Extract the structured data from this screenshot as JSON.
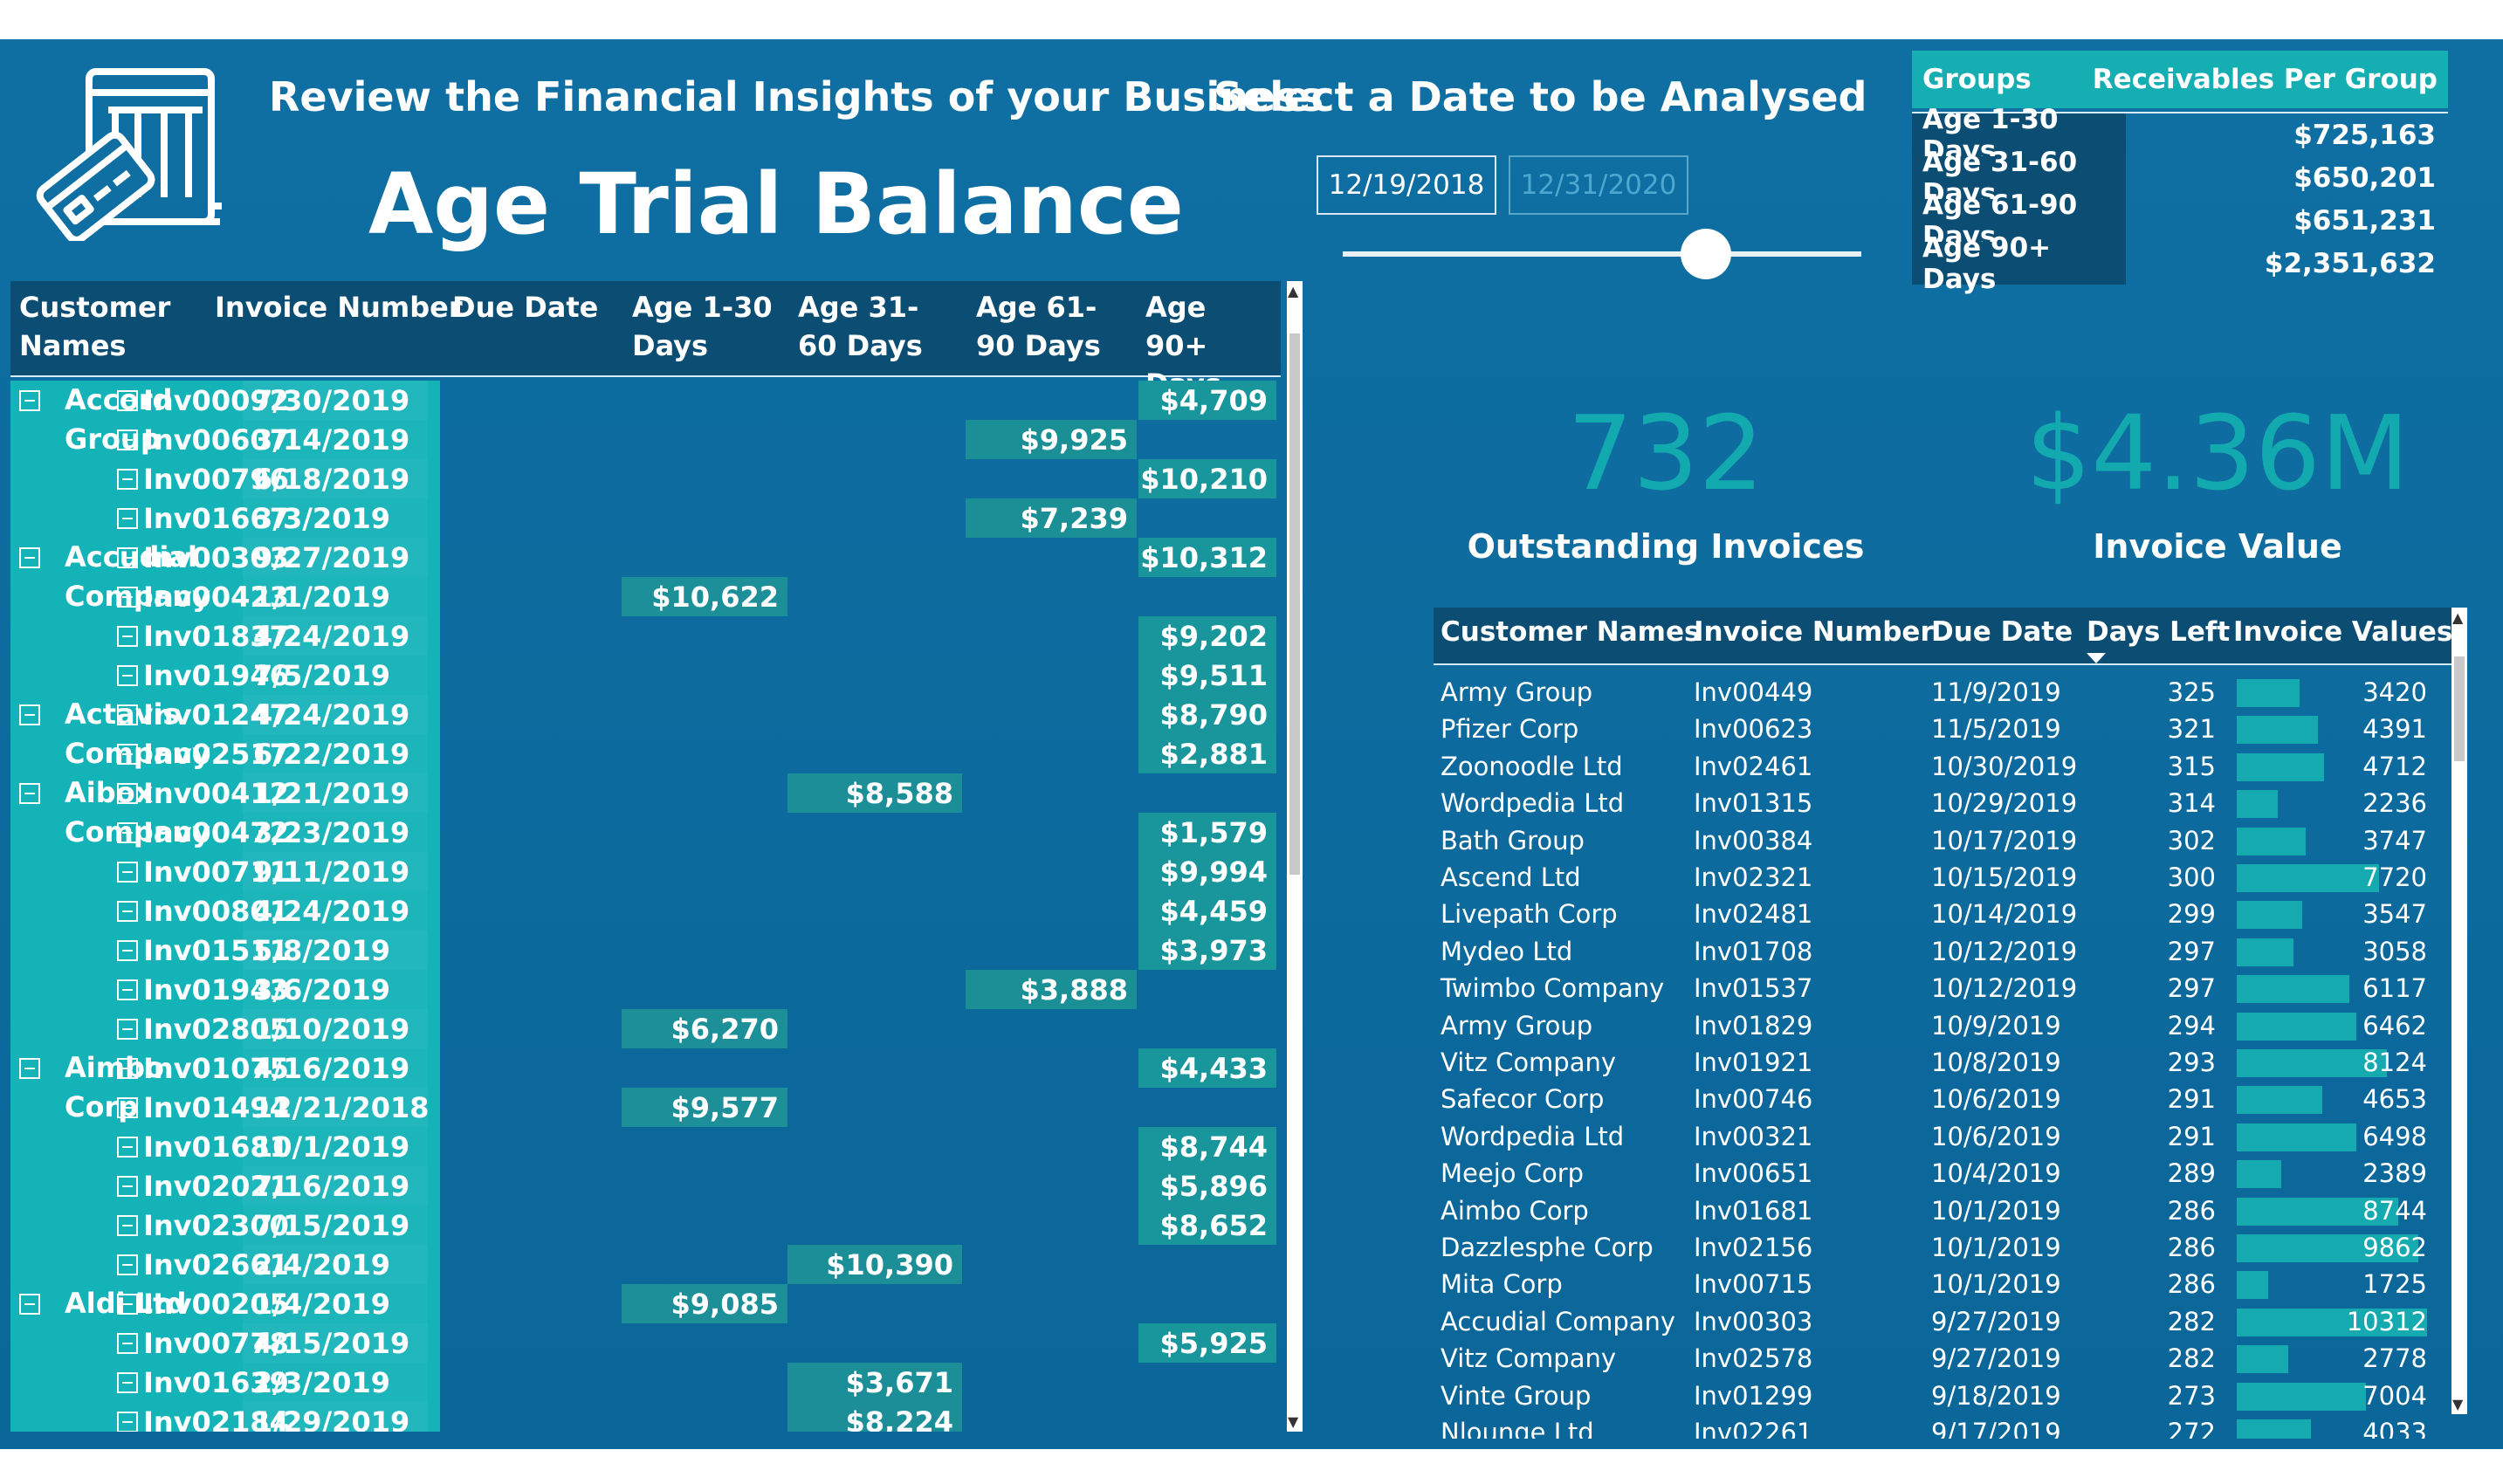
{
  "header": {
    "headline": "Review the Financial Insights of your Business",
    "select_date_label": "Select a Date to be Analysed",
    "page_title": "Age Trial Balance"
  },
  "date_filter": {
    "start": "12/19/2018",
    "end": "12/31/2020",
    "slider_position": 0.7
  },
  "groups_table": {
    "headers": [
      "Groups",
      "Receivables Per Group"
    ],
    "rows": [
      {
        "group": "Age 1-30 Days",
        "value": "$725,163"
      },
      {
        "group": "Age 31-60 Days",
        "value": "$650,201"
      },
      {
        "group": "Age 61-90 Days",
        "value": "$651,231"
      },
      {
        "group": "Age 90+ Days",
        "value": "$2,351,632"
      }
    ]
  },
  "kpis": {
    "outstanding_invoices": {
      "value": "732",
      "label": "Outstanding Invoices"
    },
    "invoice_value": {
      "value": "$4.36M",
      "label": "Invoice Value"
    }
  },
  "matrix": {
    "headers": {
      "customer": "Customer Names",
      "invoice": "Invoice Number",
      "due": "Due Date",
      "age1": "Age 1-30 Days",
      "age2": "Age 31-60 Days",
      "age3": "Age 61-90 Days",
      "age4": "Age 90+ Days"
    },
    "customers": [
      {
        "name": "Accord Group",
        "start": 0
      },
      {
        "name": "Accudial Company",
        "start": 4
      },
      {
        "name": "Actavis Company",
        "start": 8
      },
      {
        "name": "Aibox Company",
        "start": 10
      },
      {
        "name": "Aimbo Corp",
        "start": 17
      },
      {
        "name": "Aldi Ltd",
        "start": 23
      }
    ],
    "rows": [
      {
        "invoice": "Inv00092",
        "due": "7/30/2019",
        "age": 4,
        "value": "$4,709"
      },
      {
        "invoice": "Inv00607",
        "due": "3/14/2019",
        "age": 3,
        "value": "$9,925"
      },
      {
        "invoice": "Inv00796",
        "due": "6/18/2019",
        "age": 4,
        "value": "$10,210"
      },
      {
        "invoice": "Inv01667",
        "due": "3/3/2019",
        "age": 3,
        "value": "$7,239"
      },
      {
        "invoice": "Inv00303",
        "due": "9/27/2019",
        "age": 4,
        "value": "$10,312"
      },
      {
        "invoice": "Inv00423",
        "due": "1/1/2019",
        "age": 1,
        "value": "$10,622"
      },
      {
        "invoice": "Inv01837",
        "due": "4/24/2019",
        "age": 4,
        "value": "$9,202"
      },
      {
        "invoice": "Inv01946",
        "due": "7/5/2019",
        "age": 4,
        "value": "$9,511"
      },
      {
        "invoice": "Inv01247",
        "due": "4/24/2019",
        "age": 4,
        "value": "$8,790"
      },
      {
        "invoice": "Inv02517",
        "due": "6/22/2019",
        "age": 4,
        "value": "$2,881"
      },
      {
        "invoice": "Inv00412",
        "due": "1/21/2019",
        "age": 2,
        "value": "$8,588"
      },
      {
        "invoice": "Inv00472",
        "due": "3/23/2019",
        "age": 4,
        "value": "$1,579"
      },
      {
        "invoice": "Inv00711",
        "due": "9/11/2019",
        "age": 4,
        "value": "$9,994"
      },
      {
        "invoice": "Inv00801",
        "due": "4/24/2019",
        "age": 4,
        "value": "$4,459"
      },
      {
        "invoice": "Inv01511",
        "due": "5/8/2019",
        "age": 4,
        "value": "$3,973"
      },
      {
        "invoice": "Inv01943",
        "due": "3/6/2019",
        "age": 3,
        "value": "$3,888"
      },
      {
        "invoice": "Inv02805",
        "due": "1/10/2019",
        "age": 1,
        "value": "$6,270"
      },
      {
        "invoice": "Inv01075",
        "due": "4/16/2019",
        "age": 4,
        "value": "$4,433"
      },
      {
        "invoice": "Inv01494",
        "due": "12/21/2018",
        "age": 1,
        "value": "$9,577"
      },
      {
        "invoice": "Inv01681",
        "due": "10/1/2019",
        "age": 4,
        "value": "$8,744"
      },
      {
        "invoice": "Inv02021",
        "due": "7/16/2019",
        "age": 4,
        "value": "$5,896"
      },
      {
        "invoice": "Inv02300",
        "due": "7/15/2019",
        "age": 4,
        "value": "$8,652"
      },
      {
        "invoice": "Inv02661",
        "due": "2/4/2019",
        "age": 2,
        "value": "$10,390"
      },
      {
        "invoice": "Inv00205",
        "due": "1/4/2019",
        "age": 1,
        "value": "$9,085"
      },
      {
        "invoice": "Inv00778",
        "due": "4/15/2019",
        "age": 4,
        "value": "$5,925"
      },
      {
        "invoice": "Inv01639",
        "due": "2/3/2019",
        "age": 2,
        "value": "$3,671"
      },
      {
        "invoice": "Inv02184",
        "due": "1/29/2019",
        "age": 2,
        "value": "$8,224"
      }
    ]
  },
  "invoice_table": {
    "headers": {
      "customer": "Customer Names",
      "invoice": "Invoice Number",
      "due": "Due Date",
      "days": "Days Left",
      "value": "Invoice Values"
    },
    "max_value": 10312,
    "rows": [
      {
        "customer": "Army Group",
        "invoice": "Inv00449",
        "due": "11/9/2019",
        "days": "325",
        "value": "3420"
      },
      {
        "customer": "Pfizer Corp",
        "invoice": "Inv00623",
        "due": "11/5/2019",
        "days": "321",
        "value": "4391"
      },
      {
        "customer": "Zoonoodle Ltd",
        "invoice": "Inv02461",
        "due": "10/30/2019",
        "days": "315",
        "value": "4712"
      },
      {
        "customer": "Wordpedia Ltd",
        "invoice": "Inv01315",
        "due": "10/29/2019",
        "days": "314",
        "value": "2236"
      },
      {
        "customer": "Bath Group",
        "invoice": "Inv00384",
        "due": "10/17/2019",
        "days": "302",
        "value": "3747"
      },
      {
        "customer": "Ascend Ltd",
        "invoice": "Inv02321",
        "due": "10/15/2019",
        "days": "300",
        "value": "7720"
      },
      {
        "customer": "Livepath Corp",
        "invoice": "Inv02481",
        "due": "10/14/2019",
        "days": "299",
        "value": "3547"
      },
      {
        "customer": "Mydeo Ltd",
        "invoice": "Inv01708",
        "due": "10/12/2019",
        "days": "297",
        "value": "3058"
      },
      {
        "customer": "Twimbo Company",
        "invoice": "Inv01537",
        "due": "10/12/2019",
        "days": "297",
        "value": "6117"
      },
      {
        "customer": "Army Group",
        "invoice": "Inv01829",
        "due": "10/9/2019",
        "days": "294",
        "value": "6462"
      },
      {
        "customer": "Vitz Company",
        "invoice": "Inv01921",
        "due": "10/8/2019",
        "days": "293",
        "value": "8124"
      },
      {
        "customer": "Safecor Corp",
        "invoice": "Inv00746",
        "due": "10/6/2019",
        "days": "291",
        "value": "4653"
      },
      {
        "customer": "Wordpedia Ltd",
        "invoice": "Inv00321",
        "due": "10/6/2019",
        "days": "291",
        "value": "6498"
      },
      {
        "customer": "Meejo Corp",
        "invoice": "Inv00651",
        "due": "10/4/2019",
        "days": "289",
        "value": "2389"
      },
      {
        "customer": "Aimbo Corp",
        "invoice": "Inv01681",
        "due": "10/1/2019",
        "days": "286",
        "value": "8744"
      },
      {
        "customer": "Dazzlesphe Corp",
        "invoice": "Inv02156",
        "due": "10/1/2019",
        "days": "286",
        "value": "9862"
      },
      {
        "customer": "Mita Corp",
        "invoice": "Inv00715",
        "due": "10/1/2019",
        "days": "286",
        "value": "1725"
      },
      {
        "customer": "Accudial Company",
        "invoice": "Inv00303",
        "due": "9/27/2019",
        "days": "282",
        "value": "10312"
      },
      {
        "customer": "Vitz Company",
        "invoice": "Inv02578",
        "due": "9/27/2019",
        "days": "282",
        "value": "2778"
      },
      {
        "customer": "Vinte Group",
        "invoice": "Inv01299",
        "due": "9/18/2019",
        "days": "273",
        "value": "7004"
      },
      {
        "customer": "Nlounge Ltd",
        "invoice": "Inv02261",
        "due": "9/17/2019",
        "days": "272",
        "value": "4033"
      }
    ]
  },
  "colors": {
    "background": "#0f6fa3",
    "header_dark": "#0b4d73",
    "accent_teal": "#14b3b8",
    "kpi": "#12aaaf"
  },
  "icons": {
    "logo": "invoice-card-icon",
    "expand": "collapse-icon",
    "sort": "sort-desc-icon"
  }
}
